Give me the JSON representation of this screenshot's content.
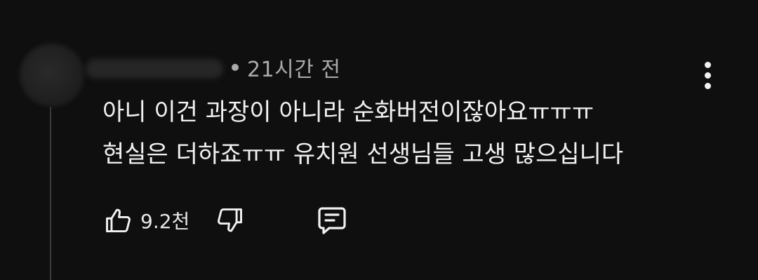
{
  "comment": {
    "time_ago": "21시간 전",
    "lines": [
      "아니 이건 과장이 아니라 순화버전이잖아요ㅠㅠㅠ",
      "현실은 더하죠ㅠㅠ 유치원 선생님들 고생 많으십니다"
    ],
    "like_count": "9.2천"
  },
  "icons": {
    "like": "thumbs-up-icon",
    "dislike": "thumbs-down-icon",
    "reply": "comment-icon",
    "menu": "more-vertical-icon"
  },
  "colors": {
    "background": "#0f0f0f",
    "text": "#f1f1f1",
    "meta": "#aaaaaa"
  }
}
